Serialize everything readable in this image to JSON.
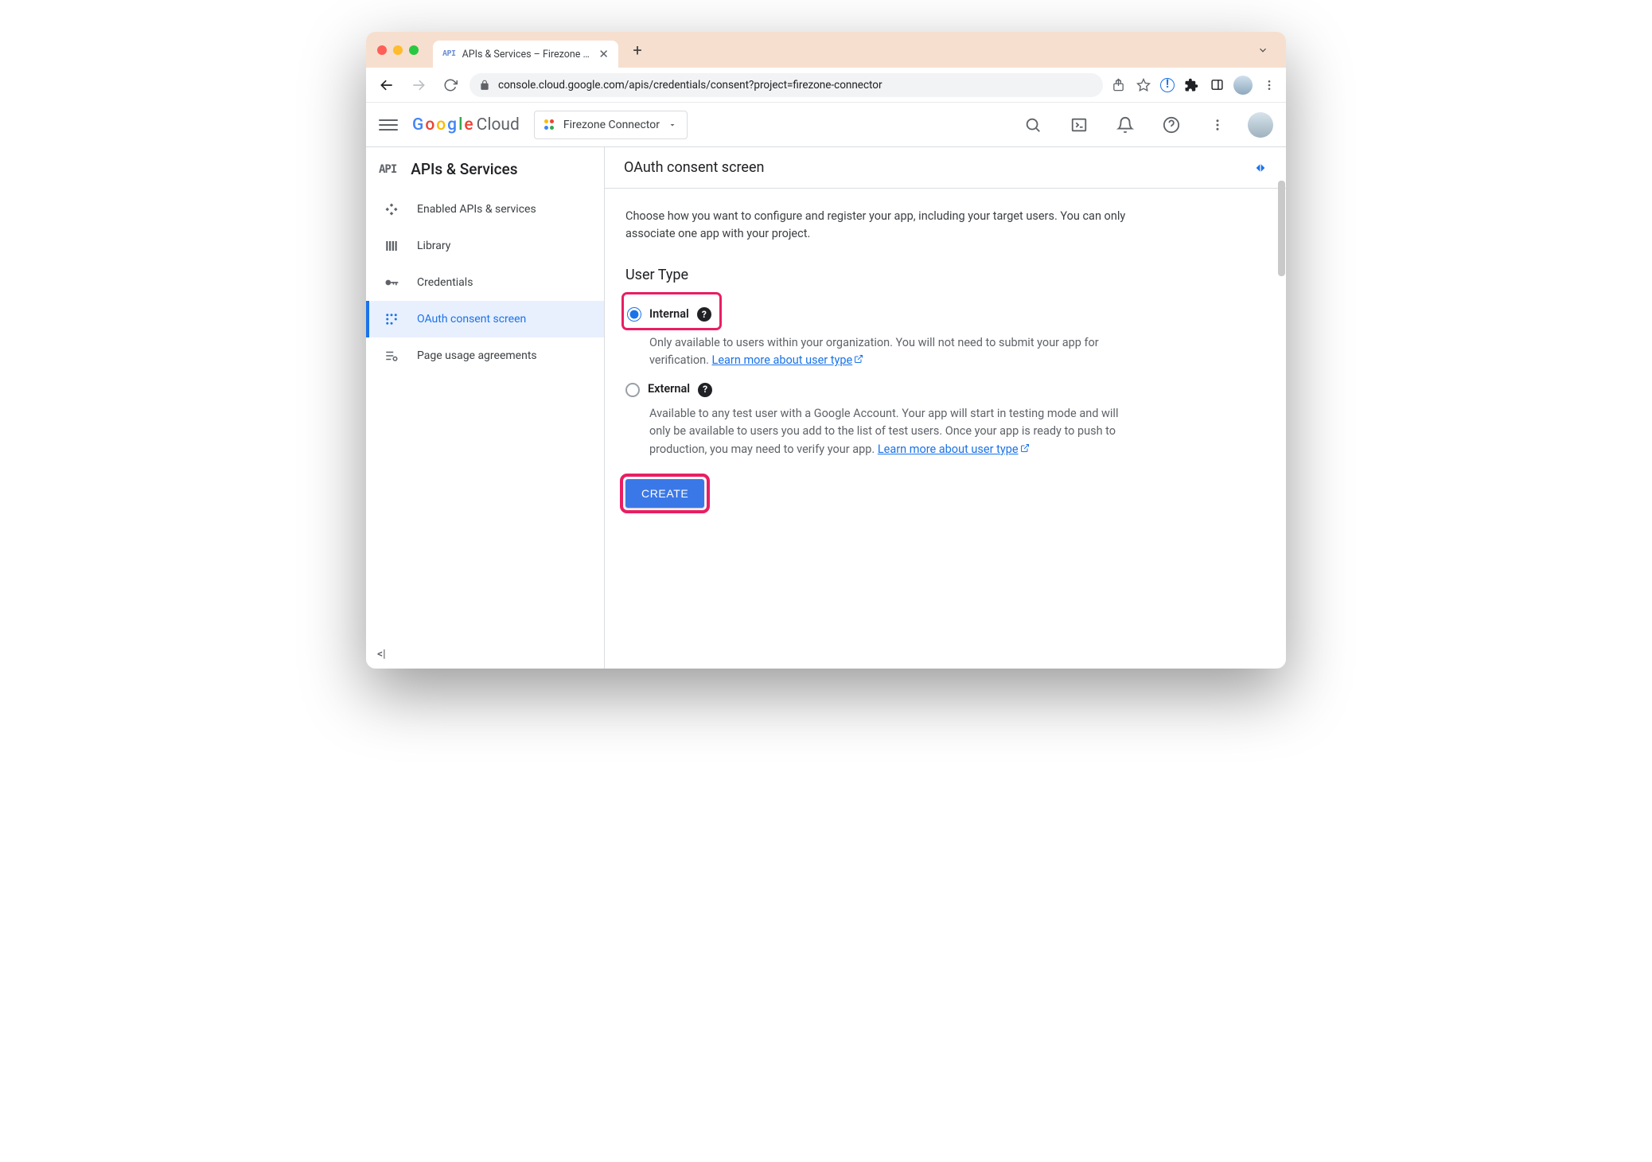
{
  "browser": {
    "tab_title": "APIs & Services – Firezone Co",
    "tab_favicon": "API",
    "url": "console.cloud.google.com/apis/credentials/consent?project=firezone-connector"
  },
  "header": {
    "logo_word": "Google",
    "logo_suffix": "Cloud",
    "project_name": "Firezone Connector"
  },
  "sidebar": {
    "title_prefix": "API",
    "title": "APIs & Services",
    "items": [
      {
        "icon": "diamond",
        "label": "Enabled APIs & services"
      },
      {
        "icon": "library",
        "label": "Library"
      },
      {
        "icon": "key",
        "label": "Credentials"
      },
      {
        "icon": "consent",
        "label": "OAuth consent screen"
      },
      {
        "icon": "list-gear",
        "label": "Page usage agreements"
      }
    ]
  },
  "content": {
    "page_title": "OAuth consent screen",
    "intro": "Choose how you want to configure and register your app, including your target users. You can only associate one app with your project.",
    "section_title": "User Type",
    "internal": {
      "label": "Internal",
      "desc": "Only available to users within your organization. You will not need to submit your app for verification. ",
      "link": "Learn more about user type"
    },
    "external": {
      "label": "External",
      "desc": "Available to any test user with a Google Account. Your app will start in testing mode and will only be available to users you add to the list of test users. Once your app is ready to push to production, you may need to verify your app. ",
      "link": "Learn more about user type"
    },
    "create_button": "CREATE"
  }
}
